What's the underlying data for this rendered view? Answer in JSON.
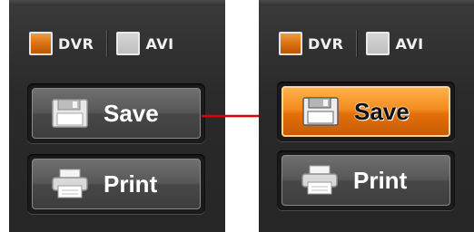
{
  "panels": [
    {
      "formats": [
        {
          "label": "DVR",
          "checked": true
        },
        {
          "label": "AVI",
          "checked": false
        }
      ],
      "save": {
        "label": "Save",
        "state": "normal"
      },
      "print": {
        "label": "Print",
        "state": "normal"
      }
    },
    {
      "formats": [
        {
          "label": "DVR",
          "checked": true
        },
        {
          "label": "AVI",
          "checked": false
        }
      ],
      "save": {
        "label": "Save",
        "state": "highlighted"
      },
      "print": {
        "label": "Print",
        "state": "normal"
      }
    }
  ],
  "colors": {
    "highlight": "#f28c20",
    "arrow": "#e00000",
    "panel_bg": "#2e2e2e"
  },
  "icons": {
    "save": "floppy-disk-icon",
    "print": "printer-icon"
  }
}
